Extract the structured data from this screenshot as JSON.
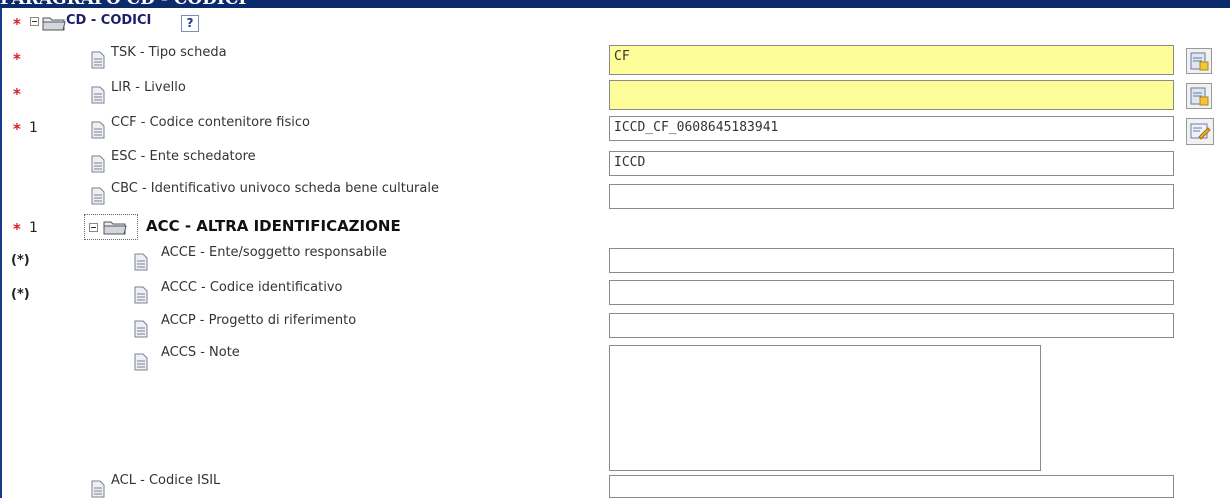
{
  "window": {
    "title": "PARAGRAFO CD - CODICI"
  },
  "section": {
    "label": "CD - CODICI",
    "required_marker": "*",
    "help_label": "?"
  },
  "fields": {
    "tsk": {
      "label": "TSK - Tipo scheda",
      "value": "CF",
      "marker": "*"
    },
    "lir": {
      "label": "LIR - Livello",
      "value": "",
      "marker": "*"
    },
    "ccf": {
      "label": "CCF - Codice contenitore fisico",
      "value": "ICCD_CF_0608645183941",
      "marker": "*",
      "count": "1"
    },
    "esc": {
      "label": "ESC - Ente schedatore",
      "value": "ICCD"
    },
    "cbc": {
      "label": "CBC - Identificativo univoco scheda bene culturale",
      "value": ""
    },
    "acl": {
      "label": "ACL - Codice ISIL",
      "value": ""
    }
  },
  "acc": {
    "label": "ACC - ALTRA IDENTIFICAZIONE",
    "marker": "*",
    "count": "1",
    "acce": {
      "label": "ACCE - Ente/soggetto responsabile",
      "value": "",
      "marker": "(*)"
    },
    "accc": {
      "label": "ACCC - Codice identificativo",
      "value": "",
      "marker": "(*)"
    },
    "accp": {
      "label": "ACCP - Progetto di riferimento",
      "value": ""
    },
    "accs": {
      "label": "ACCS - Note",
      "value": ""
    }
  },
  "colors": {
    "title_bar": "#0b2a6b",
    "required_marker": "#d42020",
    "required_field_bg": "#fdfd9a",
    "group_label": "#1d1d6b"
  }
}
